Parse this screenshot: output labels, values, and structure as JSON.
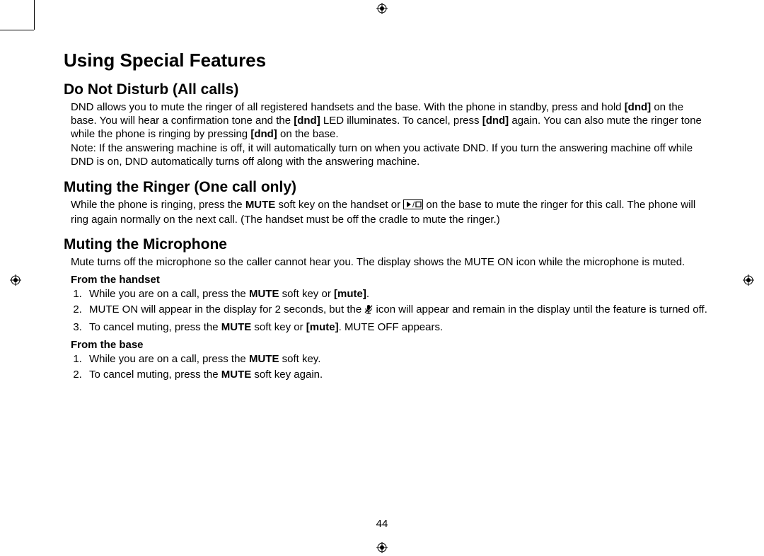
{
  "title": "Using Special Features",
  "page_number": "44",
  "sections": {
    "dnd": {
      "heading": "Do Not Disturb (All calls)",
      "p1a": "DND allows you to mute the ringer of all registered handsets and the base. With the phone in standby, press and hold ",
      "p1b": "[dnd]",
      "p1c": " on the base. You will hear a confirmation tone and the ",
      "p1d": "[dnd]",
      "p1e": " LED illuminates. To cancel, press ",
      "p1f": "[dnd]",
      "p1g": " again. You can also mute the ringer tone while the phone is ringing by pressing ",
      "p1h": "[dnd]",
      "p1i": " on the base.",
      "p2": "Note: If the answering machine is off, it will automatically turn on when you activate DND. If you turn the answering machine off while DND is on, DND automatically turns off along with the answering machine."
    },
    "ringer": {
      "heading": "Muting the Ringer (One call only)",
      "p1a": "While the phone is ringing, press the ",
      "p1b": "MUTE",
      "p1c": " soft key on the handset or ",
      "p1d": " on the base to mute the ringer for this call. The phone will ring again normally on the next call. (The handset must be off the cradle to mute the ringer.)"
    },
    "mic": {
      "heading": "Muting the Microphone",
      "intro": "Mute turns off the microphone so the caller cannot hear you. The display shows the MUTE ON icon while the microphone is muted.",
      "handset": {
        "heading": "From the handset",
        "li1a": "While you are on a call, press the ",
        "li1b": "MUTE",
        "li1c": " soft key or ",
        "li1d": "[mute]",
        "li1e": ".",
        "li2a": "MUTE ON will appear in the display for 2 seconds, but the ",
        "li2b": " icon will appear and remain in the display until the feature is turned off.",
        "li3a": "To cancel muting, press the ",
        "li3b": "MUTE",
        "li3c": " soft key or ",
        "li3d": "[mute]",
        "li3e": ". MUTE OFF appears."
      },
      "base": {
        "heading": "From the base",
        "li1a": "While you are on a call, press the ",
        "li1b": "MUTE",
        "li1c": " soft key.",
        "li2a": "To cancel muting, press the ",
        "li2b": "MUTE",
        "li2c": " soft key again."
      }
    }
  },
  "icons": {
    "play_stop": "play-stop-icon",
    "mic_mute": "mic-mute-icon",
    "registration": "registration-mark-icon"
  }
}
